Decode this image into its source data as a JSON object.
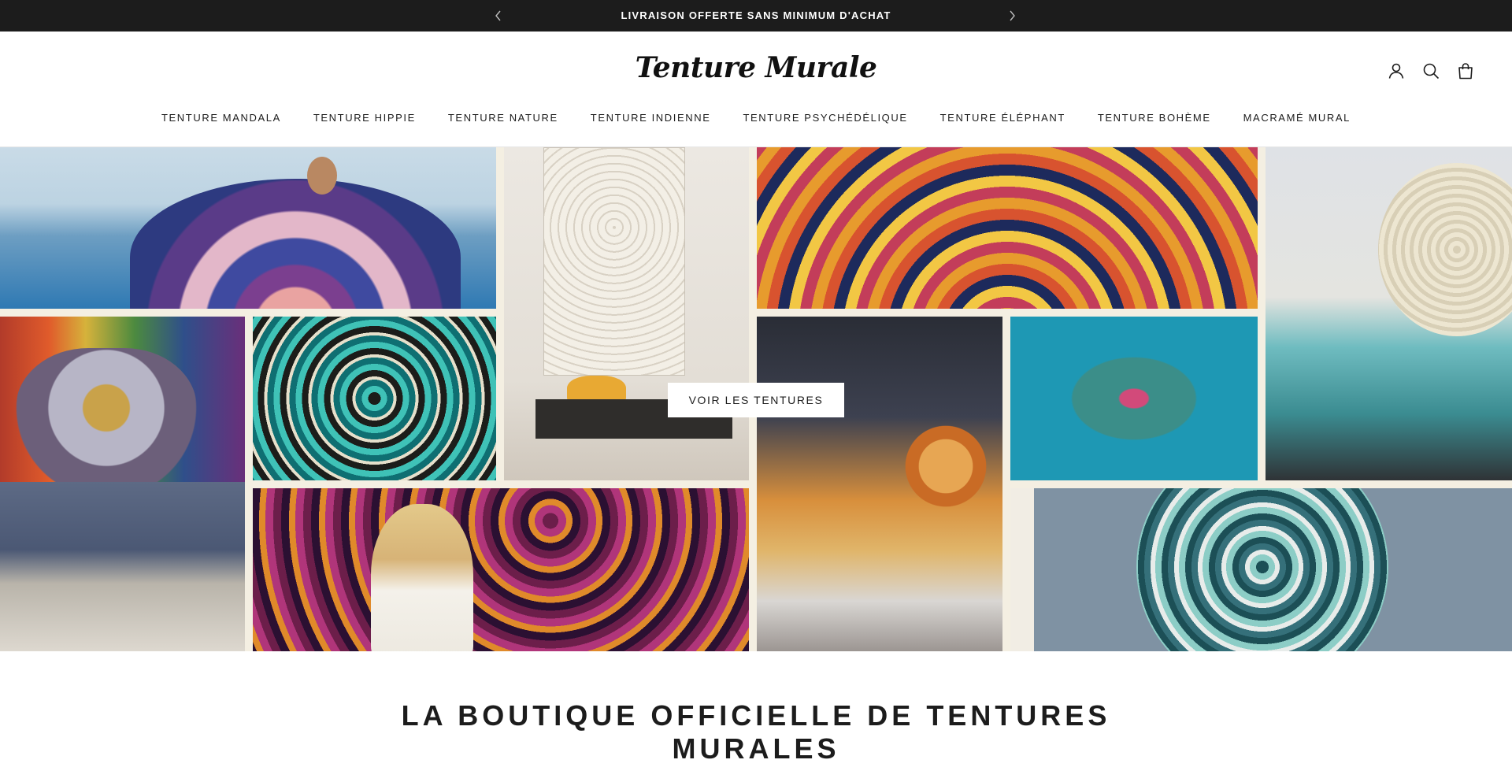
{
  "announcement": {
    "text": "LIVRAISON OFFERTE SANS MINIMUM D'ACHAT",
    "prev_icon": "chevron-left-icon",
    "next_icon": "chevron-right-icon"
  },
  "header": {
    "logo_text": "Tenture Murale",
    "icons": [
      "account-icon",
      "search-icon",
      "cart-icon"
    ]
  },
  "nav": {
    "items": [
      "TENTURE MANDALA",
      "TENTURE HIPPIE",
      "TENTURE NATURE",
      "TENTURE INDIENNE",
      "TENTURE PSYCHÉDÉLIQUE",
      "TENTURE ÉLÉPHANT",
      "TENTURE BOHÈME",
      "MACRAMÉ MURAL"
    ]
  },
  "hero": {
    "cta_label": "VOIR LES TENTURES"
  },
  "section": {
    "title": "LA BOUTIQUE OFFICIELLE DE TENTURES MURALES"
  },
  "colors": {
    "announcement_bg": "#1c1c1c",
    "text": "#1c1c1c",
    "collage_gap": "#f4efe2"
  }
}
